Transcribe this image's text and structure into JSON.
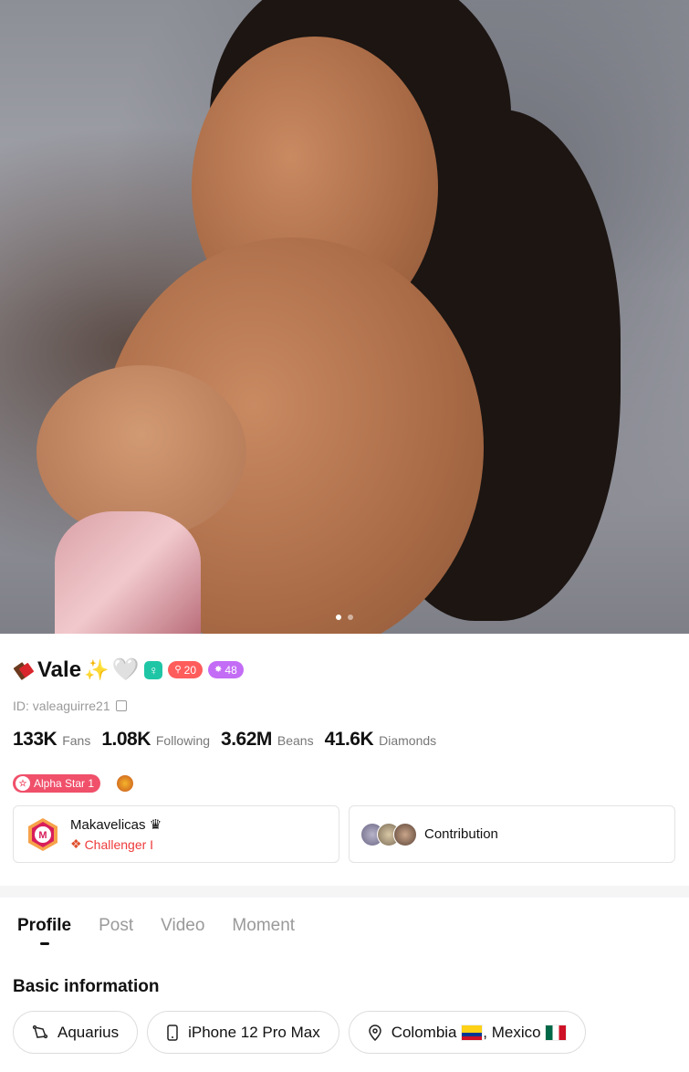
{
  "hero": {
    "photo_count": 2,
    "active_index": 0
  },
  "profile": {
    "name": "Vale",
    "emoji_prefix": "chocolate-bar-icon",
    "emoji_suffix": [
      "✨",
      "🤍"
    ],
    "badges": {
      "gender_icon": "female-badge-icon",
      "level_red": "20",
      "level_purple": "48"
    },
    "id_text": "ID: valeaguirre21"
  },
  "stats": [
    {
      "value": "133K",
      "label": "Fans"
    },
    {
      "value": "1.08K",
      "label": "Following"
    },
    {
      "value": "3.62M",
      "label": "Beans"
    },
    {
      "value": "41.6K",
      "label": "Diamonds"
    }
  ],
  "medals": {
    "alpha_label": "Alpha Star 1"
  },
  "family": {
    "name": "Makavelicas",
    "crown": "♛",
    "rank": "Challenger I"
  },
  "contribution": {
    "label": "Contribution"
  },
  "tabs": [
    "Profile",
    "Post",
    "Video",
    "Moment"
  ],
  "basic_info": {
    "title": "Basic information",
    "zodiac": "Aquarius",
    "device": "iPhone 12 Pro Max",
    "location_a": "Colombia",
    "location_sep": ",",
    "location_b": "Mexico"
  },
  "colors": {
    "accent_red": "#ee3a3a",
    "gender_teal": "#1fc6a6",
    "level_red": "#ff5c5c",
    "level_purple": "#c36cf5",
    "alpha_pink": "#f0506a"
  }
}
